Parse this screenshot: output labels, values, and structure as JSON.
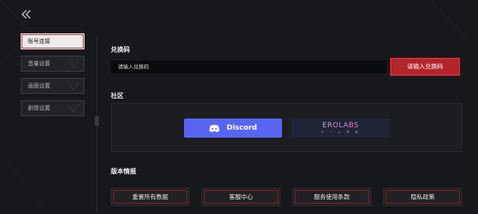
{
  "sidebar": {
    "items": [
      {
        "label": "账号连接",
        "active": true
      },
      {
        "label": "音量设置",
        "active": false
      },
      {
        "label": "画面设置",
        "active": false
      },
      {
        "label": "剧情设置",
        "active": false
      }
    ]
  },
  "redeem": {
    "title": "兑换码",
    "input_value": "请输入兑换码",
    "button_label": "请输入兑换码"
  },
  "community": {
    "title": "社区",
    "discord_label": "Discord",
    "erolabs_label": "EROLABS",
    "erolabs_sub": "ゲ ー ム 専 用"
  },
  "version": {
    "title": "版本情报"
  },
  "footer": {
    "buttons": [
      "重置所有数据",
      "客服中心",
      "服务使用条款",
      "隐私政策"
    ]
  },
  "colors": {
    "accent": "#b3242b",
    "discord": "#5865f2",
    "background": "#17181b"
  },
  "icons": {
    "back": "double-chevron-left-icon",
    "discord": "discord-logo-icon"
  }
}
